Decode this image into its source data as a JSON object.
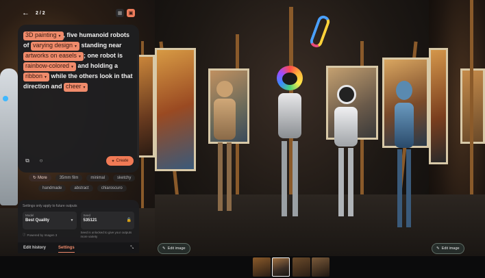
{
  "header": {
    "counter": "2 / 2"
  },
  "prompt": {
    "segments": [
      {
        "type": "chip",
        "text": "3D painting"
      },
      {
        "type": "text",
        "text": ", five humanoid robots of "
      },
      {
        "type": "chip",
        "text": "varying design"
      },
      {
        "type": "text",
        "text": " standing near "
      },
      {
        "type": "chip",
        "text": "artworks on easels"
      },
      {
        "type": "text",
        "text": "; one robot is "
      },
      {
        "type": "chip",
        "text": "rainbow-colored"
      },
      {
        "type": "text",
        "text": " and holding a "
      },
      {
        "type": "chip",
        "text": "ribbon"
      },
      {
        "type": "text",
        "text": " while the others look in that direction and "
      },
      {
        "type": "chip",
        "text": "cheer"
      }
    ]
  },
  "create_label": "Create",
  "styles": {
    "more_label": "More",
    "row1": [
      "35mm film",
      "minimal",
      "sketchy"
    ],
    "row2": [
      "handmade",
      "abstract",
      "chiaroscuro"
    ]
  },
  "settings": {
    "note": "Settings only apply to future outputs",
    "model_label": "Model",
    "model_value": "Best Quality",
    "powered_by": "Powered by Imagen 3",
    "seed_label": "Seed",
    "seed_value": "535121",
    "seed_note": "Seed is unlocked to give your outputs more variety"
  },
  "tabs": {
    "edit_history": "Edit history",
    "settings": "Settings"
  },
  "edit_image_label": "Edit image",
  "colors": {
    "accent": "#f08b6b",
    "panel": "#1e1e20",
    "chip": "#f08b6b"
  }
}
